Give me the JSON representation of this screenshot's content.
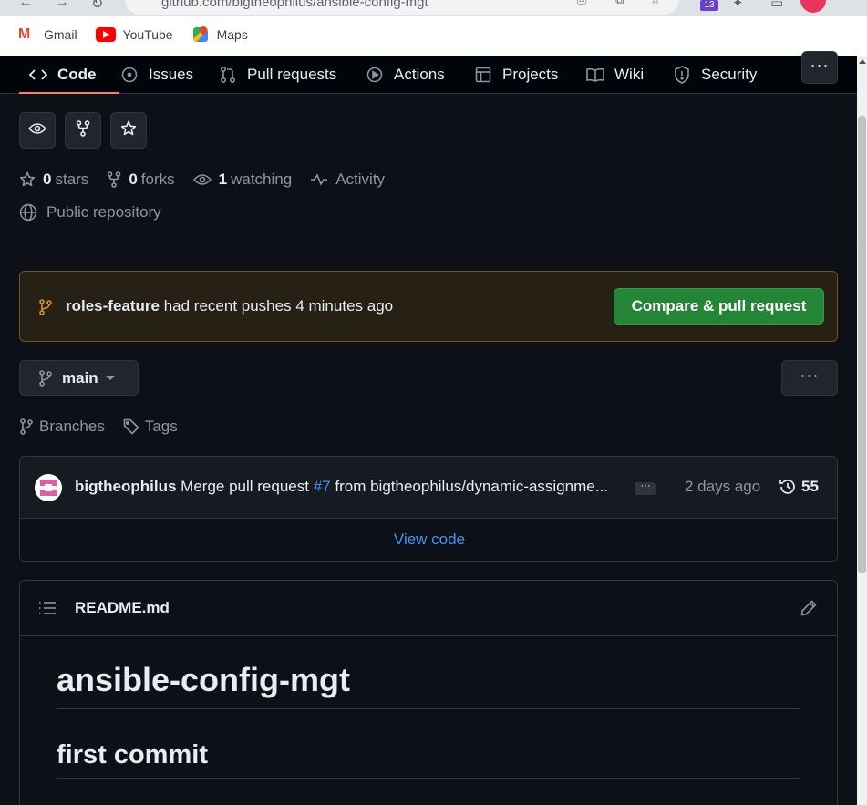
{
  "browser": {
    "url": "github.com/bigtheophilus/ansible-config-mgt",
    "extension_badge": "13",
    "bookmarks": [
      {
        "label": "Gmail",
        "icon": "gmail-icon"
      },
      {
        "label": "YouTube",
        "icon": "youtube-icon"
      },
      {
        "label": "Maps",
        "icon": "maps-icon"
      }
    ]
  },
  "repo_nav": {
    "tabs": [
      {
        "label": "Code",
        "icon": "code-icon",
        "active": true
      },
      {
        "label": "Issues",
        "icon": "issue-icon"
      },
      {
        "label": "Pull requests",
        "icon": "pull-request-icon"
      },
      {
        "label": "Actions",
        "icon": "play-icon"
      },
      {
        "label": "Projects",
        "icon": "table-icon"
      },
      {
        "label": "Wiki",
        "icon": "book-icon"
      },
      {
        "label": "Security",
        "icon": "shield-icon"
      }
    ],
    "more_label": "···"
  },
  "repo_meta": {
    "stars_count": "0",
    "stars_label": "stars",
    "forks_count": "0",
    "forks_label": "forks",
    "watching_count": "1",
    "watching_label": "watching",
    "activity_label": "Activity",
    "visibility": "Public repository"
  },
  "push_banner": {
    "branch": "roles-feature",
    "message": "had recent pushes 4 minutes ago",
    "button": "Compare & pull request",
    "accent": "#d29922"
  },
  "branch_selector": {
    "current": "main",
    "more_label": "···"
  },
  "links": {
    "branches": "Branches",
    "tags": "Tags"
  },
  "latest_commit": {
    "author": "bigtheophilus",
    "message_prefix": "Merge pull request",
    "pr_number": "#7",
    "message_suffix": "from bigtheophilus/dynamic-assignme...",
    "ellipsis": "···",
    "time": "2 days ago",
    "commit_count": "55",
    "view_code": "View code"
  },
  "readme": {
    "filename": "README.md",
    "h1": "ansible-config-mgt",
    "h2": "first commit"
  },
  "colors": {
    "background": "#0d1117",
    "primary_button": "#238636",
    "link": "#4493f8",
    "active_tab_underline": "#f78166"
  }
}
